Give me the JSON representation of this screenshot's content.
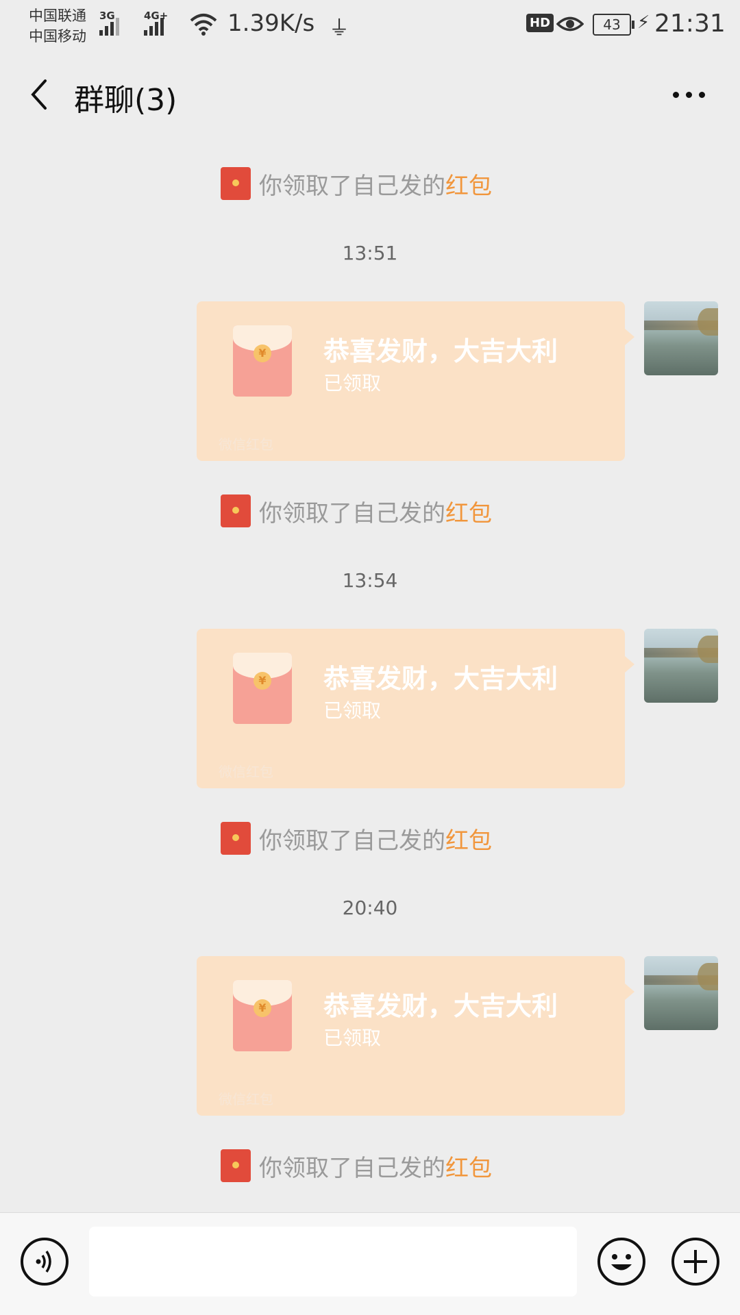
{
  "status_bar": {
    "carrier1": "中国联通",
    "carrier2": "中国移动",
    "net1": "3G",
    "net2": "4G+",
    "speed": "1.39K/s",
    "hd": "HD",
    "battery": "43",
    "time": "21:31"
  },
  "header": {
    "title": "群聊(3)"
  },
  "notice": {
    "prefix": "你领取了自己发的",
    "link": "红包"
  },
  "timestamps": [
    "13:51",
    "13:54",
    "20:40"
  ],
  "packet": {
    "title": "恭喜发财，大吉大利",
    "status": "已领取",
    "brand": "微信红包",
    "coin": "¥"
  },
  "icons": {
    "back": "chevron-left-icon",
    "more": "ellipsis-icon",
    "voice": "voice-icon",
    "emoji": "smiley-icon",
    "plus": "plus-icon"
  },
  "colors": {
    "background": "#ededed",
    "packet_bg": "#fbe1c6",
    "link": "#f1963c",
    "notice_text": "#9a9a9a"
  }
}
